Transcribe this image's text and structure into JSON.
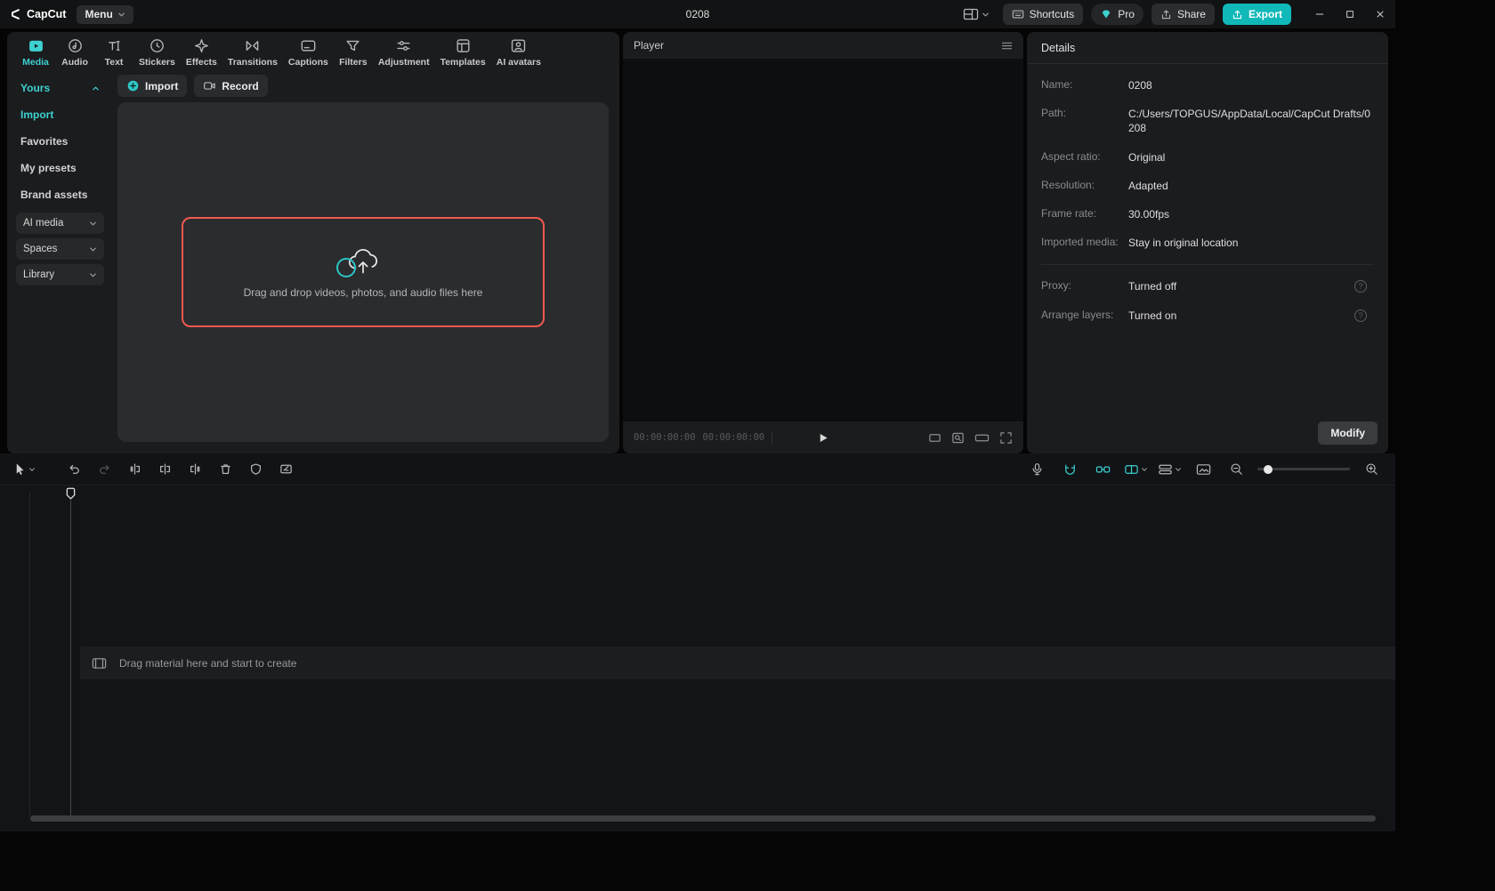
{
  "titlebar": {
    "app_name": "CapCut",
    "menu_label": "Menu",
    "doc_title": "0208",
    "shortcuts_label": "Shortcuts",
    "pro_label": "Pro",
    "share_label": "Share",
    "export_label": "Export"
  },
  "ribbon_tabs": [
    {
      "label": "Media"
    },
    {
      "label": "Audio"
    },
    {
      "label": "Text"
    },
    {
      "label": "Stickers"
    },
    {
      "label": "Effects"
    },
    {
      "label": "Transitions"
    },
    {
      "label": "Captions"
    },
    {
      "label": "Filters"
    },
    {
      "label": "Adjustment"
    },
    {
      "label": "Templates"
    },
    {
      "label": "AI avatars"
    }
  ],
  "sidebar": {
    "items": [
      {
        "label": "Yours"
      },
      {
        "label": "Import"
      },
      {
        "label": "Favorites"
      },
      {
        "label": "My presets"
      },
      {
        "label": "Brand assets"
      },
      {
        "label": "AI media"
      },
      {
        "label": "Spaces"
      },
      {
        "label": "Library"
      }
    ]
  },
  "media_panel": {
    "import_label": "Import",
    "record_label": "Record",
    "dropzone_text": "Drag and drop videos, photos, and audio files here"
  },
  "player": {
    "title": "Player",
    "current_time": "00:00:00:00",
    "total_time": "00:00:00:00"
  },
  "details": {
    "title": "Details",
    "fields": [
      {
        "label": "Name:",
        "value": "0208"
      },
      {
        "label": "Path:",
        "value": "C:/Users/TOPGUS/AppData/Local/CapCut Drafts/0208"
      },
      {
        "label": "Aspect ratio:",
        "value": "Original"
      },
      {
        "label": "Resolution:",
        "value": "Adapted"
      },
      {
        "label": "Frame rate:",
        "value": "30.00fps"
      },
      {
        "label": "Imported media:",
        "value": "Stay in original location"
      }
    ],
    "settings": [
      {
        "label": "Proxy:",
        "value": "Turned off"
      },
      {
        "label": "Arrange layers:",
        "value": "Turned on"
      }
    ],
    "modify_label": "Modify"
  },
  "timeline": {
    "placeholder": "Drag material here and start to create"
  },
  "colors": {
    "accent": "#3ed1d1",
    "export_button": "#11b8b8",
    "dropzone_border": "#f2594f"
  }
}
